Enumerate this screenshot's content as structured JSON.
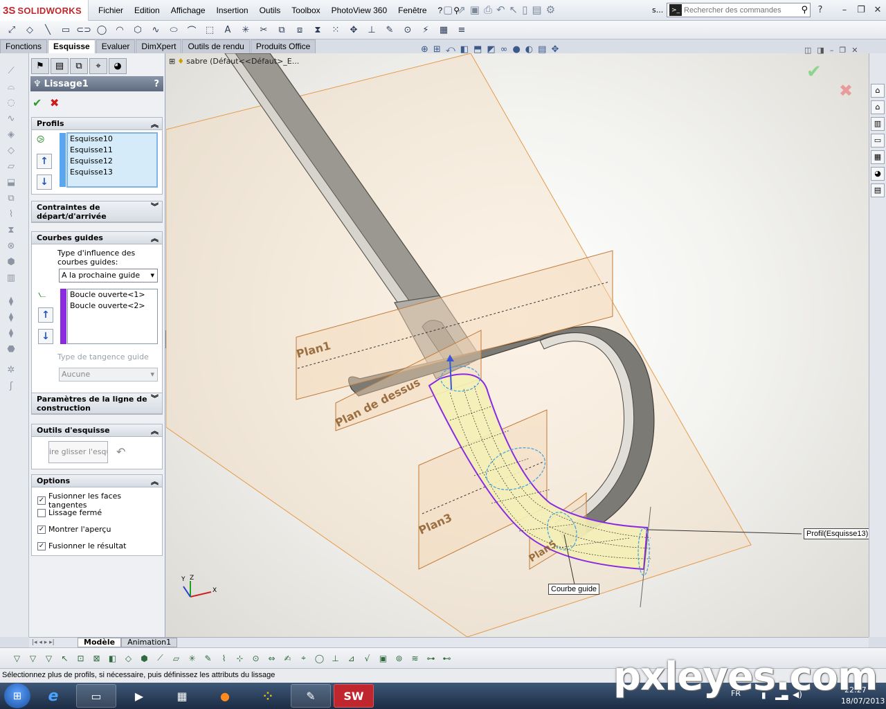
{
  "app": {
    "brand_prefix": "3S",
    "brand": "SOLIDWORKS"
  },
  "menu": [
    "Fichier",
    "Edition",
    "Affichage",
    "Insertion",
    "Outils",
    "Toolbox",
    "PhotoView 360",
    "Fenêtre",
    "?"
  ],
  "titlebar": {
    "doc_short": "s..."
  },
  "search": {
    "placeholder": "Rechercher des commandes"
  },
  "command_tabs": [
    "Fonctions",
    "Esquisse",
    "Evaluer",
    "DimXpert",
    "Outils de rendu",
    "Produits Office"
  ],
  "active_command_tab": "Esquisse",
  "property_manager": {
    "title": "Lissage1",
    "help": "?",
    "ok_icon": "check-icon",
    "cancel_icon": "cross-icon",
    "profils": {
      "header": "Profils",
      "items": [
        "Esquisse10",
        "Esquisse11",
        "Esquisse12",
        "Esquisse13"
      ]
    },
    "contraintes": {
      "header": "Contraintes de départ/d'arrivée"
    },
    "courbes_guides": {
      "header": "Courbes guides",
      "influence_label": "Type d'influence des courbes guides:",
      "influence_value": "A la prochaine guide",
      "items": [
        "Boucle ouverte<1>",
        "Boucle ouverte<2>"
      ],
      "tangence_label": "Type de tangence guide",
      "tangence_value": "Aucune"
    },
    "parametres": {
      "header": "Paramètres de la ligne de construction"
    },
    "outils_esquisse": {
      "header": "Outils d'esquisse",
      "drag_button": "ire glisser l'esquis"
    },
    "options": {
      "header": "Options",
      "items": [
        {
          "label": "Fusionner les faces tangentes",
          "checked": true
        },
        {
          "label": "Lissage fermé",
          "checked": false
        },
        {
          "label": "Montrer l'aperçu",
          "checked": true
        },
        {
          "label": "Fusionner le résultat",
          "checked": true
        }
      ]
    }
  },
  "feature_tree": {
    "node": "sabre  (Défaut<<Défaut>_E..."
  },
  "viewport": {
    "planes": [
      "Plan1",
      "Plan de dessus",
      "Plan3",
      "Plan5"
    ],
    "callouts": {
      "profil": "Profil(Esquisse13)",
      "guide": "Courbe guide"
    },
    "triad": {
      "x": "X",
      "y": "Y",
      "z": "Z"
    }
  },
  "model_tabs": [
    "Modèle",
    "Animation1"
  ],
  "active_model_tab": "Modèle",
  "status": "Sélectionnez plus de profils, si nécessaire, puis définissez les attributs du lissage",
  "tray": {
    "lang": "FR",
    "time": "22:27",
    "date": "18/07/2013"
  },
  "watermark": "pxleyes.com",
  "colors": {
    "accent_purple": "#8a2be2",
    "plane_orange": "#d9823a",
    "preview_yellow": "#f4efb6",
    "guide_blue": "#4aa3e0"
  }
}
